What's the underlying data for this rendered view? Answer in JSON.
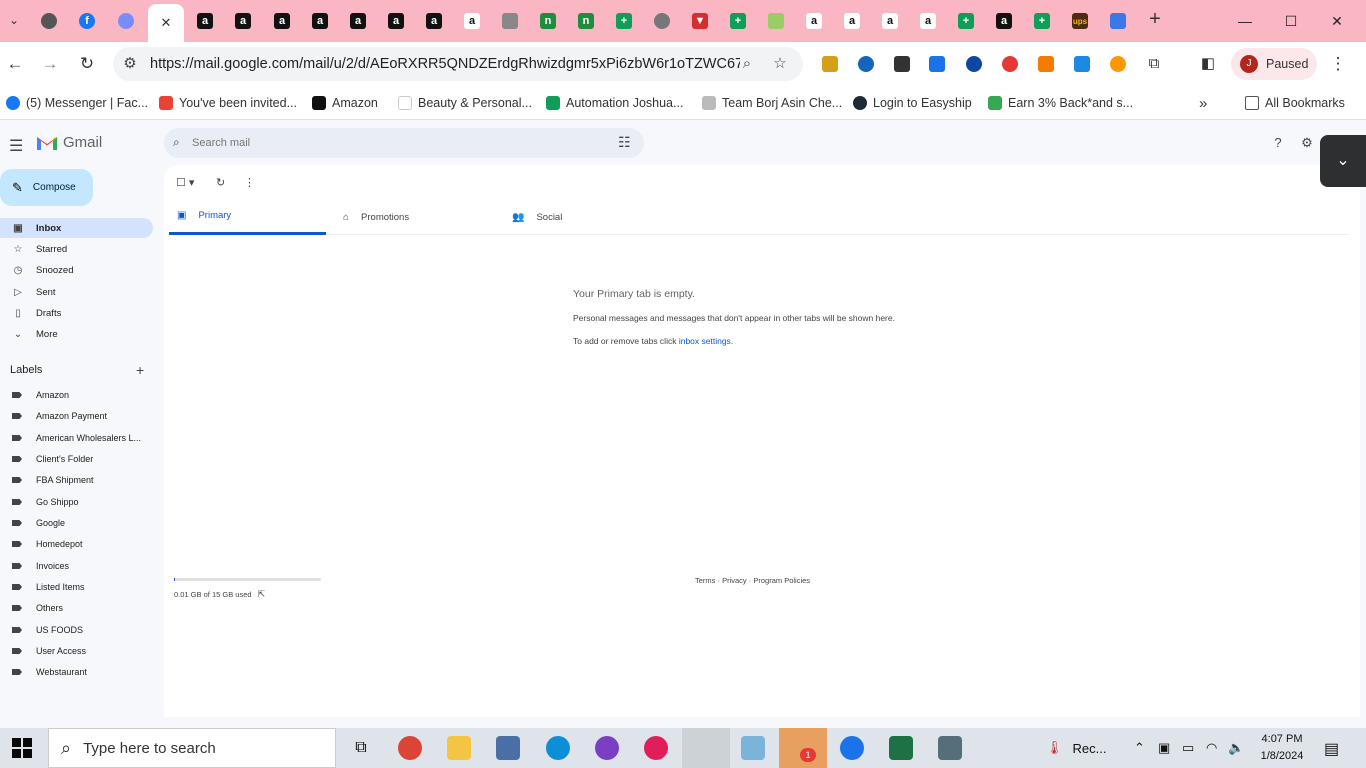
{
  "browser": {
    "address": {
      "url": "https://mail.google.com/mail/u/2/d/AEoRXRR5QNDZErdgRhwizdgmr5xPi6zbW6r1oTZWC67..."
    },
    "profile": {
      "initial": "J",
      "status": "Paused"
    },
    "bookmarks": [
      {
        "label": "(5) Messenger | Fac...",
        "icon": "facebook-icon",
        "color": "#1877f2"
      },
      {
        "label": "You've been invited...",
        "icon": "gmail-icon",
        "color": "#ea4335"
      },
      {
        "label": "Amazon",
        "icon": "amazon-icon",
        "color": "#111111"
      },
      {
        "label": "Beauty & Personal...",
        "icon": "amazon-icon",
        "color": "#ffffff"
      },
      {
        "label": "Automation Joshua...",
        "icon": "sheets-icon",
        "color": "#0f9d58"
      },
      {
        "label": "Team Borj Asin Che...",
        "icon": "team-icon",
        "color": "#bbbbbb"
      },
      {
        "label": "Login to Easyship",
        "icon": "easyship-icon",
        "color": "#1f2a36"
      },
      {
        "label": "Earn 3% Back*and s...",
        "icon": "n-icon",
        "color": "#34a853"
      }
    ],
    "all_bookmarks": "All Bookmarks"
  },
  "gmail": {
    "app_name": "Gmail",
    "search_placeholder": "Search mail",
    "compose": "Compose",
    "nav": [
      {
        "label": "Inbox",
        "icon": "inbox-icon",
        "selected": true
      },
      {
        "label": "Starred",
        "icon": "star-icon",
        "selected": false
      },
      {
        "label": "Snoozed",
        "icon": "clock-icon",
        "selected": false
      },
      {
        "label": "Sent",
        "icon": "send-icon",
        "selected": false
      },
      {
        "label": "Drafts",
        "icon": "draft-icon",
        "selected": false
      },
      {
        "label": "More",
        "icon": "chevron-down-icon",
        "selected": false
      }
    ],
    "labels_title": "Labels",
    "labels": [
      "Amazon",
      "Amazon Payment",
      "American Wholesalers L...",
      "Client's Folder",
      "FBA Shipment",
      "Go Shippo",
      "Google",
      "Homedepot",
      "Invoices",
      "Listed Items",
      "Others",
      "US FOODS",
      "User Access",
      "Webstaurant"
    ],
    "categories": [
      {
        "label": "Primary",
        "icon": "inbox-icon",
        "selected": true
      },
      {
        "label": "Promotions",
        "icon": "tag-icon",
        "selected": false
      },
      {
        "label": "Social",
        "icon": "people-icon",
        "selected": false
      }
    ],
    "empty": {
      "title": "Your Primary tab is empty.",
      "desc": "Personal messages and messages that don't appear in other tabs will be shown here.",
      "link_prefix": "To add or remove tabs click ",
      "link_text": "inbox settings",
      "link_suffix": "."
    },
    "storage": {
      "text": "0.01 GB of 15 GB used",
      "fraction": 0.001
    },
    "footer": {
      "terms": "Terms",
      "sep": " · ",
      "privacy": "Privacy",
      "policies": "Program Policies"
    }
  },
  "taskbar": {
    "search_placeholder": "Type here to search",
    "recording_label": "Rec...",
    "time": "4:07 PM",
    "date": "1/8/2024",
    "telegram_badge": "1"
  }
}
